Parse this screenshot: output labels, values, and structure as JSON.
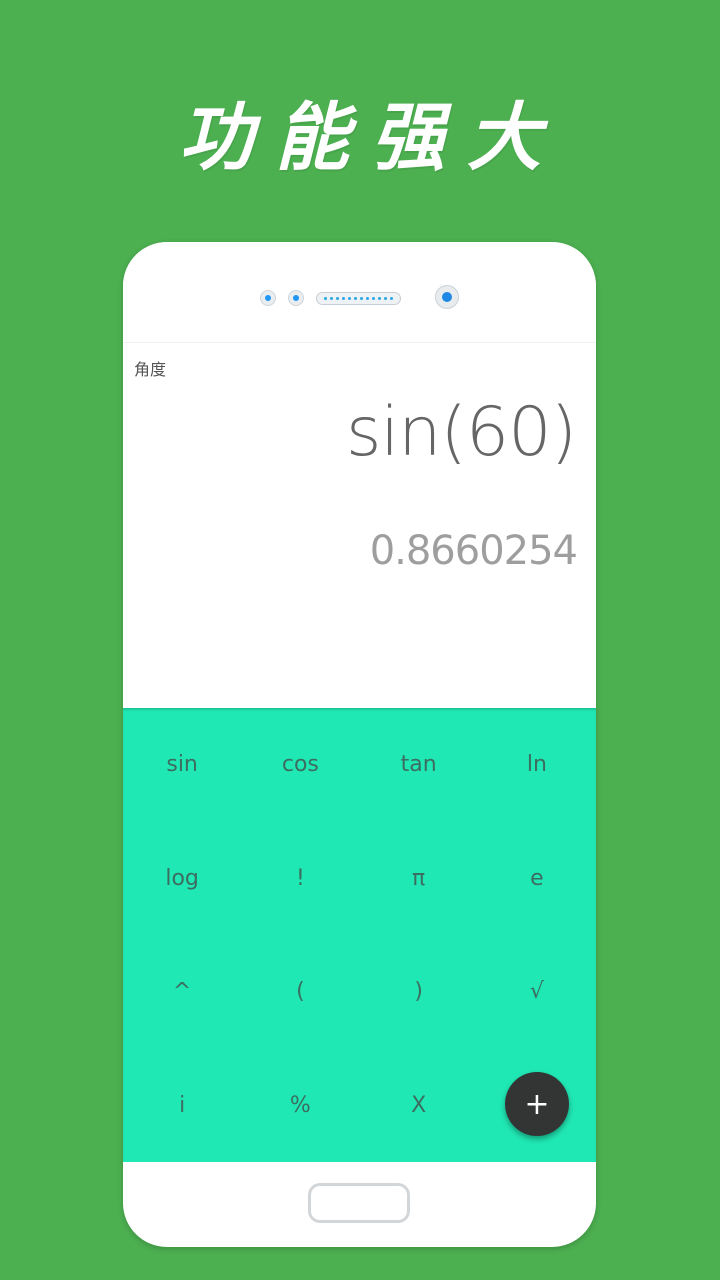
{
  "headline": "功能强大",
  "calculator": {
    "mode_label": "角度",
    "expression": "sin(60)",
    "result": "0.8660254",
    "keys": [
      {
        "label": "sin",
        "name": "key-sin"
      },
      {
        "label": "cos",
        "name": "key-cos"
      },
      {
        "label": "tan",
        "name": "key-tan"
      },
      {
        "label": "ln",
        "name": "key-ln"
      },
      {
        "label": "log",
        "name": "key-log"
      },
      {
        "label": "!",
        "name": "key-factorial"
      },
      {
        "label": "π",
        "name": "key-pi"
      },
      {
        "label": "e",
        "name": "key-e"
      },
      {
        "label": "^",
        "name": "key-power"
      },
      {
        "label": "(",
        "name": "key-open-paren"
      },
      {
        "label": ")",
        "name": "key-close-paren"
      },
      {
        "label": "√",
        "name": "key-sqrt"
      },
      {
        "label": "i",
        "name": "key-i"
      },
      {
        "label": "%",
        "name": "key-percent"
      },
      {
        "label": "X",
        "name": "key-x"
      },
      {
        "label": "",
        "name": "key-empty"
      }
    ],
    "fab_icon": "plus-icon",
    "fab_label": "+"
  },
  "colors": {
    "background": "#4caf50",
    "keypad": "#20e8b4",
    "fab": "#333535"
  }
}
